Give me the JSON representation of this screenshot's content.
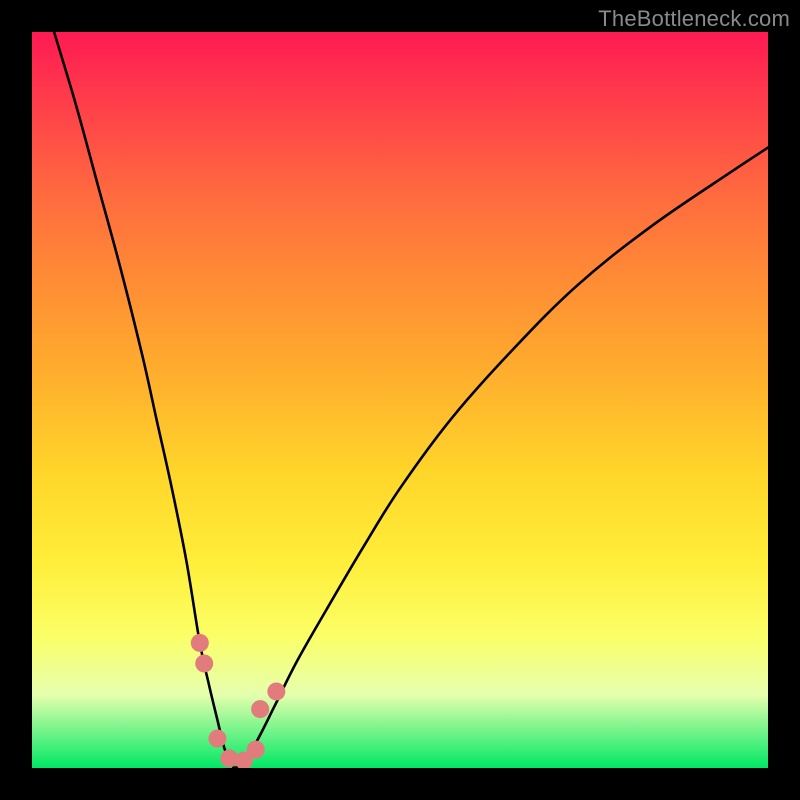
{
  "watermark": {
    "text": "TheBottleneck.com"
  },
  "colors": {
    "background": "#000000",
    "curve": "#000000",
    "dot": "#e27b7b",
    "gradient_stops": [
      "#ff1a53",
      "#ff3f4a",
      "#ff6a3f",
      "#ff8a35",
      "#ffaa2e",
      "#ffd62a",
      "#ffee3a",
      "#fbff66",
      "#e6ffae",
      "#00e865"
    ]
  },
  "chart_data": {
    "type": "line",
    "title": "",
    "xlabel": "",
    "ylabel": "",
    "xlim": [
      0,
      1
    ],
    "ylim": [
      0,
      1
    ],
    "x_optimum": 0.275,
    "note": "V-shaped bottleneck curve. y is qualitative (color gradient from green=0 to red=1). Minimum ≈0 at x≈0.275; steep on left arm, gentler on right arm.",
    "series": [
      {
        "name": "curve",
        "x": [
          0.03,
          0.06,
          0.09,
          0.12,
          0.15,
          0.17,
          0.19,
          0.21,
          0.228,
          0.24,
          0.252,
          0.262,
          0.272,
          0.275,
          0.285,
          0.296,
          0.31,
          0.33,
          0.36,
          0.4,
          0.45,
          0.5,
          0.57,
          0.65,
          0.74,
          0.84,
          0.95,
          1.0
        ],
        "y": [
          1.0,
          0.9,
          0.79,
          0.68,
          0.56,
          0.47,
          0.38,
          0.28,
          0.17,
          0.115,
          0.065,
          0.025,
          0.006,
          0.0,
          0.006,
          0.02,
          0.045,
          0.085,
          0.145,
          0.215,
          0.3,
          0.38,
          0.475,
          0.565,
          0.655,
          0.735,
          0.81,
          0.843
        ]
      }
    ],
    "markers": {
      "name": "near-optimum-dots",
      "dot_radius": 9,
      "points_xy": [
        [
          0.228,
          0.17
        ],
        [
          0.234,
          0.142
        ],
        [
          0.252,
          0.04
        ],
        [
          0.268,
          0.013
        ],
        [
          0.288,
          0.01
        ],
        [
          0.304,
          0.025
        ],
        [
          0.31,
          0.08
        ],
        [
          0.332,
          0.104
        ]
      ]
    }
  }
}
